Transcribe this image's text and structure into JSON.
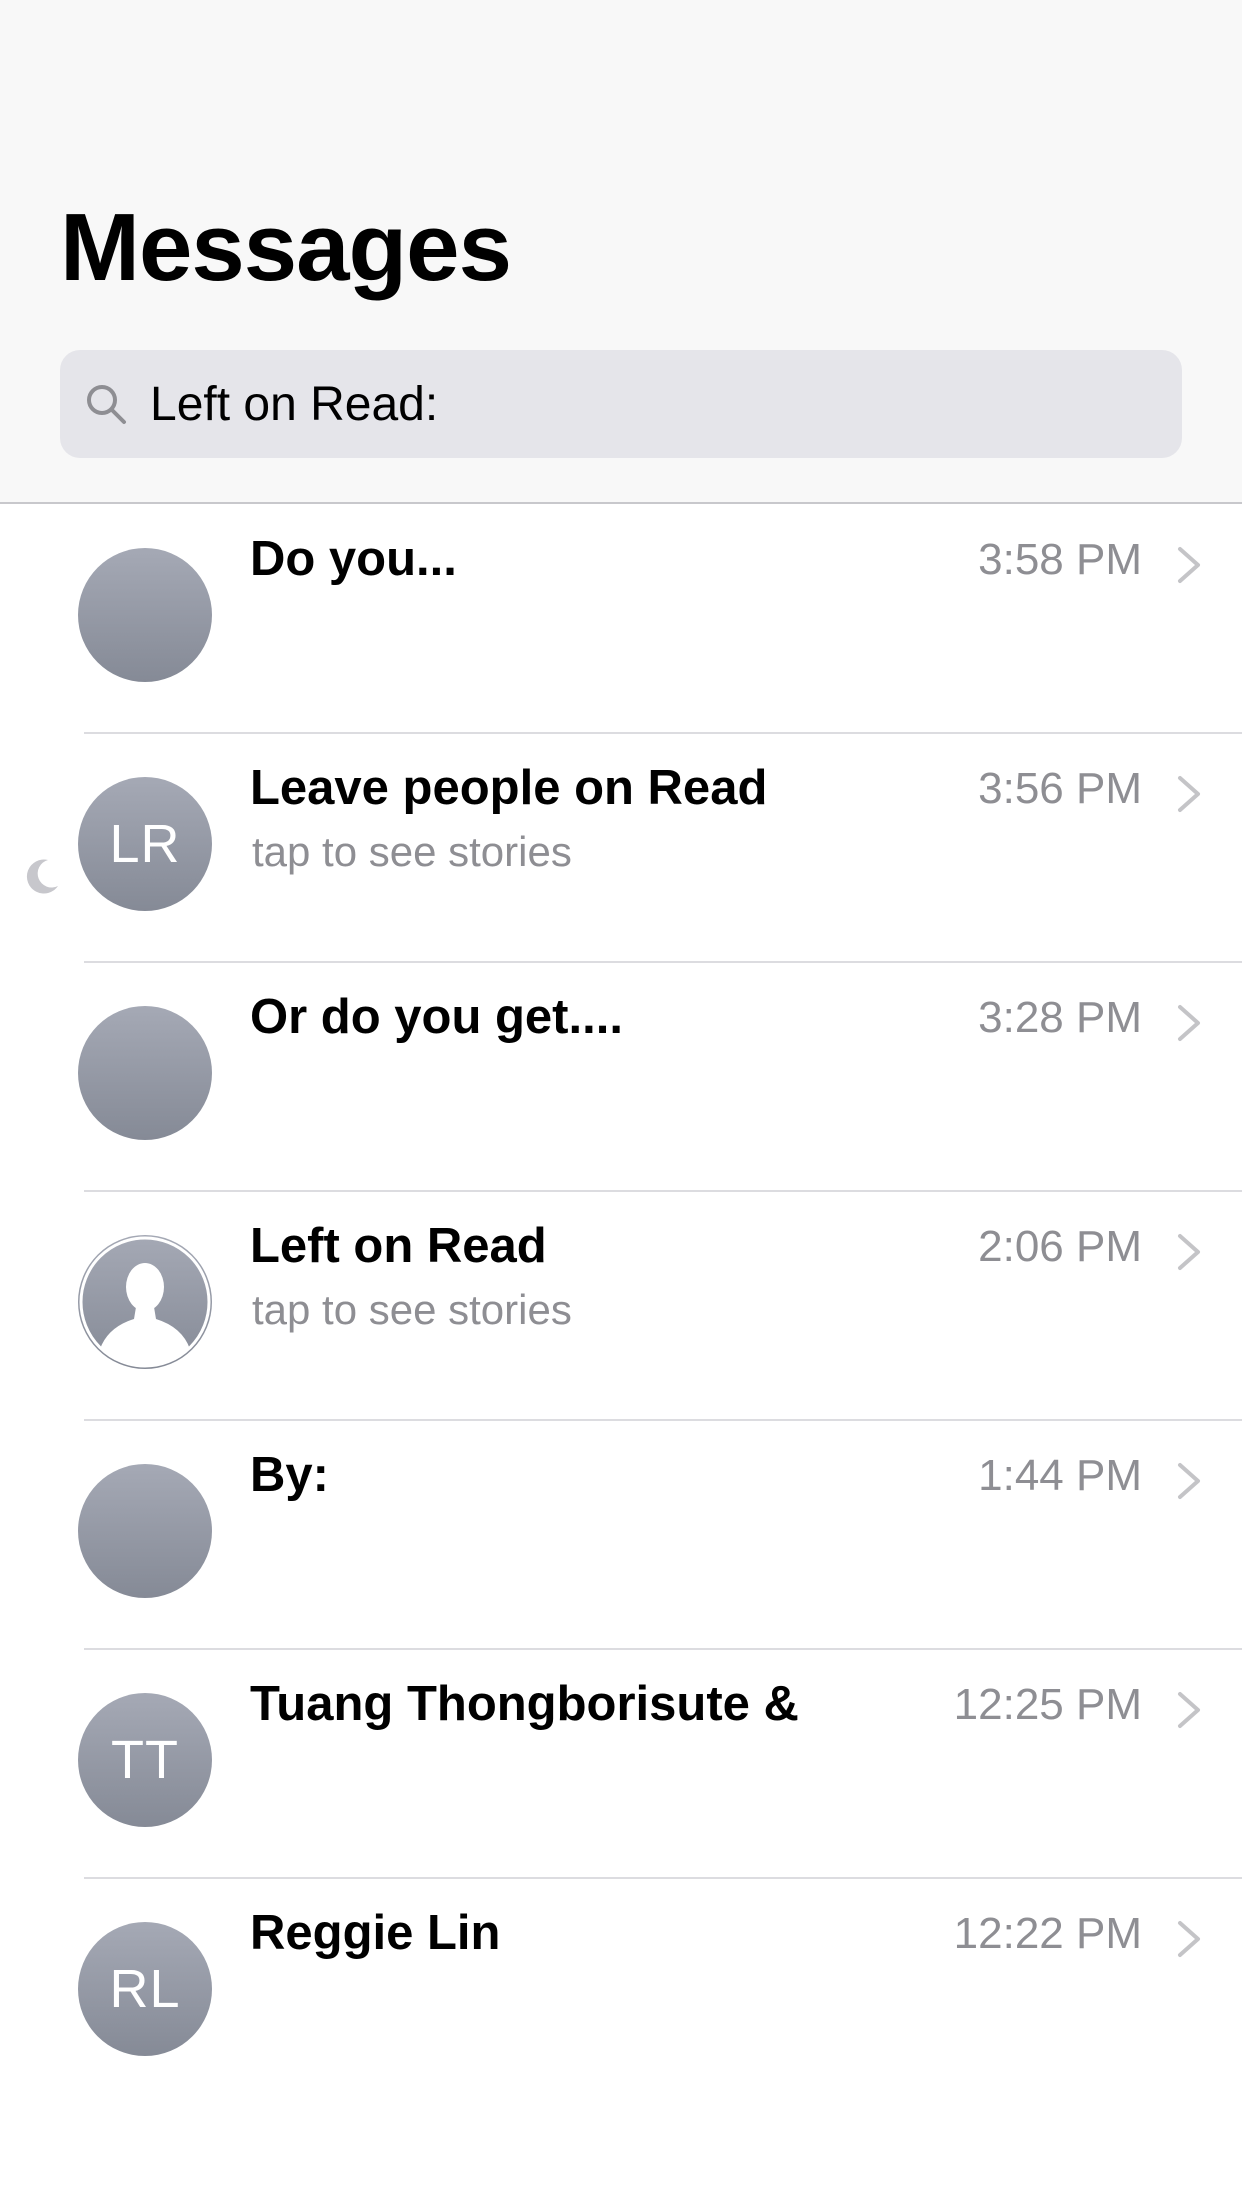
{
  "header": {
    "title": "Messages"
  },
  "search": {
    "value": "Left on Read:",
    "icon": "search-icon"
  },
  "colors": {
    "header_bg": "#f8f8f8",
    "search_bg": "#e5e5ea",
    "secondary_text": "#8e8e93",
    "avatar_gradient_top": "#a5a9b5",
    "avatar_gradient_bottom": "#858a96"
  },
  "conversations": [
    {
      "name": "Do you...",
      "preview": "",
      "time": "3:58 PM",
      "initials": "",
      "avatar": "blank",
      "muted": false
    },
    {
      "name": "Leave people on Read",
      "preview": "tap to see stories",
      "time": "3:56 PM",
      "initials": "LR",
      "avatar": "initials",
      "muted": true
    },
    {
      "name": "Or do you get....",
      "preview": "",
      "time": "3:28 PM",
      "initials": "",
      "avatar": "blank",
      "muted": false
    },
    {
      "name": "Left on Read",
      "preview": "tap to see stories",
      "time": "2:06 PM",
      "initials": "",
      "avatar": "person-silhouette",
      "muted": false
    },
    {
      "name": "By:",
      "preview": "",
      "time": "1:44 PM",
      "initials": "",
      "avatar": "blank",
      "muted": false
    },
    {
      "name": "Tuang Thongborisute &",
      "preview": "",
      "time": "12:25 PM",
      "initials": "TT",
      "avatar": "initials",
      "muted": false
    },
    {
      "name": "Reggie Lin",
      "preview": "",
      "time": "12:22 PM",
      "initials": "RL",
      "avatar": "initials",
      "muted": false
    }
  ]
}
